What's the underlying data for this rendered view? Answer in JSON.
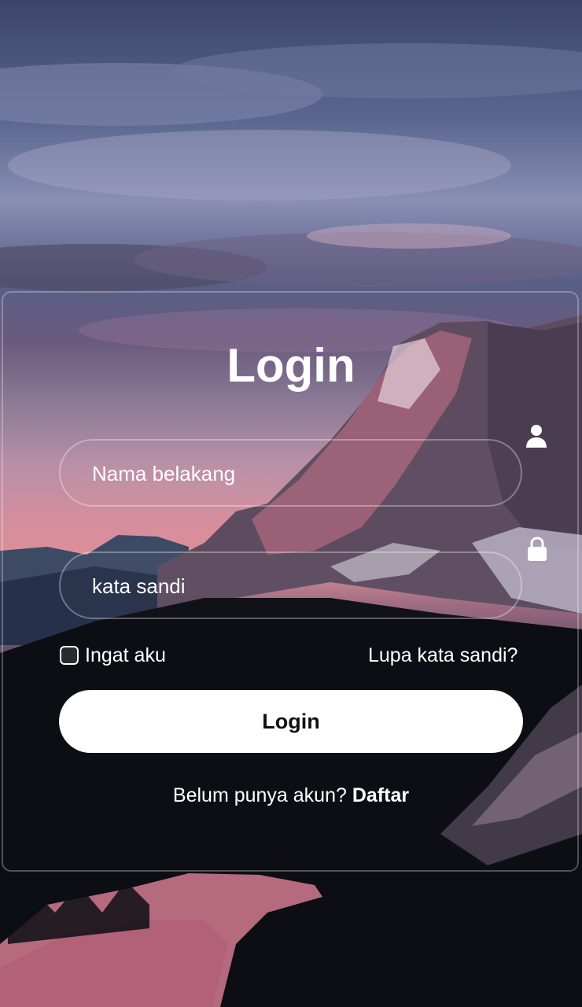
{
  "login": {
    "title": "Login",
    "username": {
      "placeholder": "Nama belakang",
      "icon": "user-icon"
    },
    "password": {
      "placeholder": "kata sandi",
      "icon": "lock-icon"
    },
    "remember_label": "Ingat aku",
    "forgot_label": "Lupa kata sandi?",
    "submit_label": "Login",
    "register_prompt": "Belum punya akun?",
    "register_label": "Daftar"
  },
  "colors": {
    "text": "#ffffff",
    "button_bg": "#ffffff",
    "button_text": "#111111"
  }
}
